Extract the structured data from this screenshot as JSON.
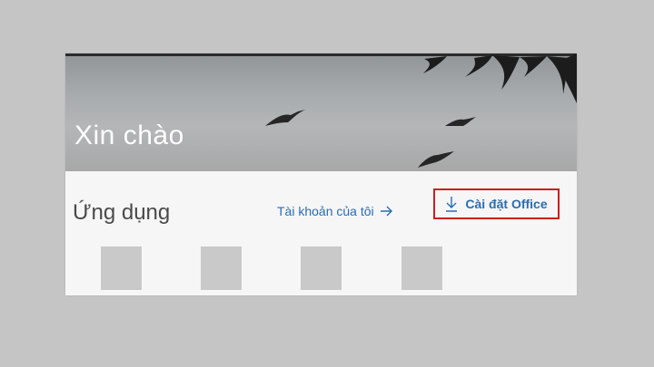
{
  "window": {
    "greeting": "Xin chào"
  },
  "apps_section": {
    "title": "Ứng dụng",
    "account_link": "Tài khoản của tôi",
    "install_button": "Cài đặt Office"
  },
  "icons": {
    "account_link_icon": "arrow-right-icon",
    "install_icon": "download-icon"
  },
  "colors": {
    "accent_link": "#2a6db0",
    "highlight_border": "#d01c1c",
    "page_background": "#c5c5c5",
    "card_background": "#f6f6f6",
    "app_tile_placeholder": "#c9c9c9"
  },
  "app_tiles": [
    "",
    "",
    "",
    ""
  ]
}
